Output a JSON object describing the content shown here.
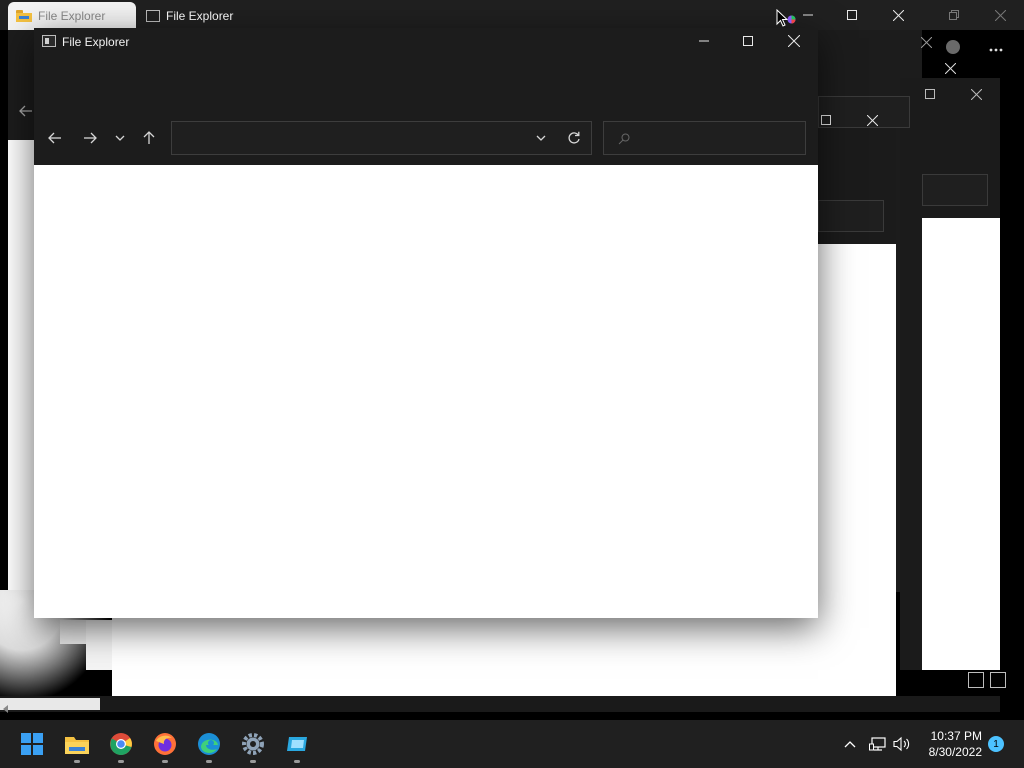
{
  "tabs": [
    {
      "label": "File Explorer"
    },
    {
      "label": "File Explorer"
    }
  ],
  "main_window": {
    "title": "File Explorer",
    "address_value": "",
    "search_placeholder": ""
  },
  "taskbar": {
    "apps": [
      {
        "name": "start-icon"
      },
      {
        "name": "file-explorer-icon"
      },
      {
        "name": "chrome-icon"
      },
      {
        "name": "firefox-icon"
      },
      {
        "name": "edge-icon"
      },
      {
        "name": "settings-icon"
      },
      {
        "name": "app-icon"
      }
    ],
    "time": "10:37 PM",
    "date": "8/30/2022",
    "notification_count": "1"
  },
  "colors": {
    "window_dark": "#1c1c1c",
    "taskbar": "#202020",
    "accent_blue": "#4cc2ff",
    "start_blue": "#3aa0f3"
  }
}
